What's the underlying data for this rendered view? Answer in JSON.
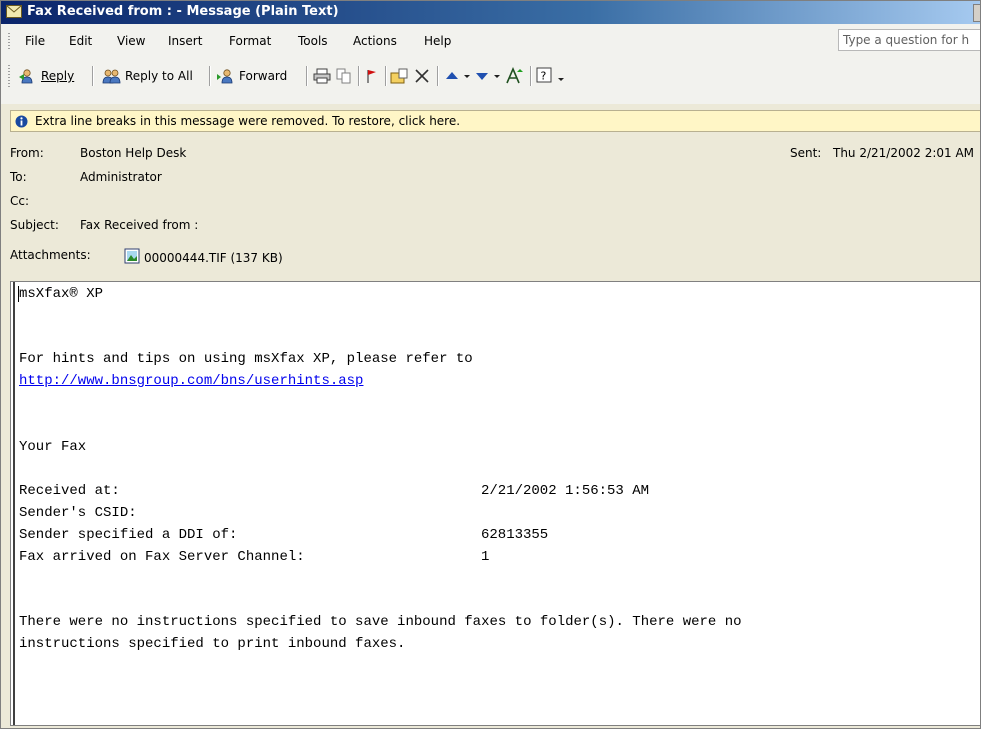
{
  "window": {
    "title": "Fax Received from :  - Message (Plain Text)"
  },
  "menu": [
    "File",
    "Edit",
    "View",
    "Insert",
    "Format",
    "Tools",
    "Actions",
    "Help"
  ],
  "ask_placeholder": "Type a question for h",
  "toolbar": {
    "reply": "Reply",
    "reply_all": "Reply to All",
    "forward": "Forward"
  },
  "infobar": {
    "text": "Extra line breaks in this message were removed. To restore, click here."
  },
  "header": {
    "from_label": "From:",
    "from_value": "Boston Help Desk",
    "sent_label": "Sent:",
    "sent_value": "Thu 2/21/2002 2:01 AM",
    "to_label": "To:",
    "to_value": "Administrator",
    "cc_label": "Cc:",
    "subject_label": "Subject:",
    "subject_value": "Fax Received from :",
    "attachments_label": "Attachments:",
    "attachment_name": "00000444.TIF (137 KB)"
  },
  "body": {
    "product": "msXfax® XP",
    "hints_line": "For hints and tips on using msXfax XP, please refer to",
    "hints_link": "http://www.bnsgroup.com/bns/userhints.asp",
    "your_fax": "Your Fax",
    "received_label": "Received at:",
    "received_value": "2/21/2002 1:56:53 AM",
    "csid_label": "Sender's CSID:",
    "ddi_label": "Sender specified a DDI of:",
    "ddi_value": "62813355",
    "channel_label": "Fax arrived on Fax Server Channel:",
    "channel_value": "1",
    "note_line1": "There were no instructions specified to save inbound faxes to folder(s). There were no",
    "note_line2": "instructions specified to print inbound faxes."
  },
  "colors": {
    "title_bar": "#0a246a",
    "infobar_bg": "#fff6c6",
    "link": "#0000ee"
  }
}
